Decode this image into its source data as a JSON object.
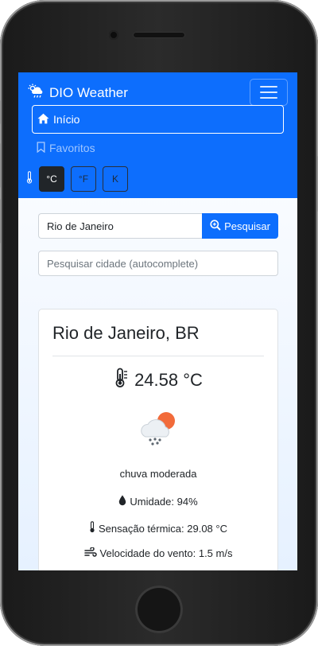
{
  "app": {
    "brand": "DIO Weather"
  },
  "nav": {
    "items": [
      {
        "label": "Início",
        "icon": "house-icon",
        "active": true
      },
      {
        "label": "Favoritos",
        "icon": "bookmark-icon",
        "active": false
      }
    ]
  },
  "units": {
    "options": [
      "°C",
      "°F",
      "K"
    ],
    "selected": "°C"
  },
  "search": {
    "value": "Rio de Janeiro",
    "button_label": "Pesquisar",
    "autocomplete_placeholder": "Pesquisar cidade (autocomplete)"
  },
  "weather": {
    "city": "Rio de Janeiro, BR",
    "temperature": "24.58 °C",
    "description": "chuva moderada",
    "humidity": "Umidade: 94%",
    "feels_like": "Sensação térmica: 29.08 °C",
    "wind": "Velocidade do vento: 1.5 m/s",
    "icon": "cloud-sun-rain-icon"
  },
  "colors": {
    "primary": "#0d6efd",
    "dark": "#212529",
    "sun": "#f26b3a"
  }
}
